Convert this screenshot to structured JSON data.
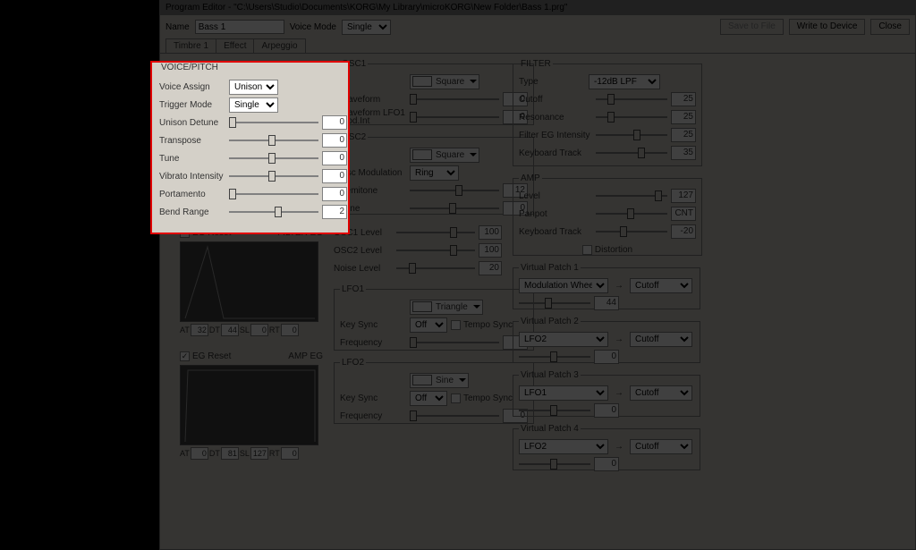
{
  "window": {
    "title": "Program Editor - \"C:\\Users\\Studio\\Documents\\KORG\\My Library\\microKORG\\New Folder\\Bass 1.prg\""
  },
  "header": {
    "name_label": "Name",
    "name_value": "Bass 1",
    "voice_mode_label": "Voice Mode",
    "voice_mode_value": "Single",
    "save_btn": "Save to File",
    "write_btn": "Write to Device",
    "close_btn": "Close"
  },
  "tabs": {
    "t1": "Timbre 1",
    "t2": "Effect",
    "t3": "Arpeggio"
  },
  "voice_pitch": {
    "legend": "VOICE/PITCH",
    "voice_assign_label": "Voice Assign",
    "voice_assign_value": "Unison",
    "trigger_mode_label": "Trigger Mode",
    "trigger_mode_value": "Single",
    "unison_detune_label": "Unison Detune",
    "unison_detune_value": "0",
    "transpose_label": "Transpose",
    "transpose_value": "0",
    "tune_label": "Tune",
    "tune_value": "0",
    "vibrato_label": "Vibrato Intensity",
    "vibrato_value": "0",
    "portamento_label": "Portamento",
    "portamento_value": "0",
    "bend_label": "Bend Range",
    "bend_value": "2"
  },
  "filter_eg": {
    "reset_label": "EG Reset",
    "title": "FILTER EG",
    "at_l": "AT",
    "at_v": "32",
    "dt_l": "DT",
    "dt_v": "44",
    "sl_l": "SL",
    "sl_v": "0",
    "rt_l": "RT",
    "rt_v": "0"
  },
  "amp_eg": {
    "reset_label": "EG Reset",
    "title": "AMP EG",
    "at_l": "AT",
    "at_v": "0",
    "dt_l": "DT",
    "dt_v": "81",
    "sl_l": "SL",
    "sl_v": "127",
    "rt_l": "RT",
    "rt_v": "0"
  },
  "osc1": {
    "legend": "OSC1",
    "wave_value": "Square",
    "waveform_label": "Waveform",
    "waveform_value": "0",
    "mod_label": "Waveform LFO1 Mod.Int",
    "mod_value": "0"
  },
  "osc2": {
    "legend": "OSC2",
    "wave_value": "Square",
    "oscmod_label": "Osc Modulation",
    "oscmod_value": "Ring",
    "semi_label": "Semitone",
    "semi_value": "12",
    "tune_label": "Tune",
    "tune_value": "0"
  },
  "mixer": {
    "osc1_label": "OSC1 Level",
    "osc1_value": "100",
    "osc2_label": "OSC2 Level",
    "osc2_value": "100",
    "noise_label": "Noise Level",
    "noise_value": "20"
  },
  "lfo1": {
    "legend": "LFO1",
    "wave_value": "Triangle",
    "keysync_label": "Key Sync",
    "keysync_value": "Off",
    "tempo_label": "Tempo Sync",
    "freq_label": "Frequency",
    "freq_value": "0"
  },
  "lfo2": {
    "legend": "LFO2",
    "wave_value": "Sine",
    "keysync_label": "Key Sync",
    "keysync_value": "Off",
    "tempo_label": "Tempo Sync",
    "freq_label": "Frequency",
    "freq_value": "0"
  },
  "filter": {
    "legend": "FILTER",
    "type_label": "Type",
    "type_value": "-12dB LPF",
    "cutoff_label": "Cutoff",
    "cutoff_value": "25",
    "reso_label": "Resonance",
    "reso_value": "25",
    "egint_label": "Filter EG Intensity",
    "egint_value": "25",
    "kbt_label": "Keyboard Track",
    "kbt_value": "35"
  },
  "amp": {
    "legend": "AMP",
    "level_label": "Level",
    "level_value": "127",
    "pan_label": "Panpot",
    "pan_value": "CNT",
    "kbt_label": "Keyboard Track",
    "kbt_value": "-20",
    "dist_label": "Distortion"
  },
  "vp1": {
    "legend": "Virtual Patch 1",
    "src": "Modulation Wheel",
    "dst": "Cutoff",
    "amt": "44"
  },
  "vp2": {
    "legend": "Virtual Patch 2",
    "src": "LFO2",
    "dst": "Cutoff",
    "amt": "0"
  },
  "vp3": {
    "legend": "Virtual Patch 3",
    "src": "LFO1",
    "dst": "Cutoff",
    "amt": "0"
  },
  "vp4": {
    "legend": "Virtual Patch 4",
    "src": "LFO2",
    "dst": "Cutoff",
    "amt": "0"
  },
  "slider_positions": {
    "vp_unison": 0,
    "vp_trans": 48,
    "vp_tune": 48,
    "vp_vib": 48,
    "vp_port": 0,
    "vp_bend": 55,
    "osc1_wave": 0,
    "osc1_mod": 0,
    "osc2_semi": 55,
    "osc2_tune": 48,
    "mix_o1": 75,
    "mix_o2": 75,
    "mix_n": 18,
    "lfo1_freq": 0,
    "lfo2_freq": 0,
    "flt_cut": 18,
    "flt_res": 18,
    "flt_eg": 58,
    "flt_kbt": 65,
    "amp_lvl": 92,
    "amp_pan": 48,
    "amp_kbt": 38,
    "vp1_amt": 40,
    "vp2_amt": 48,
    "vp3_amt": 48,
    "vp4_amt": 48
  }
}
